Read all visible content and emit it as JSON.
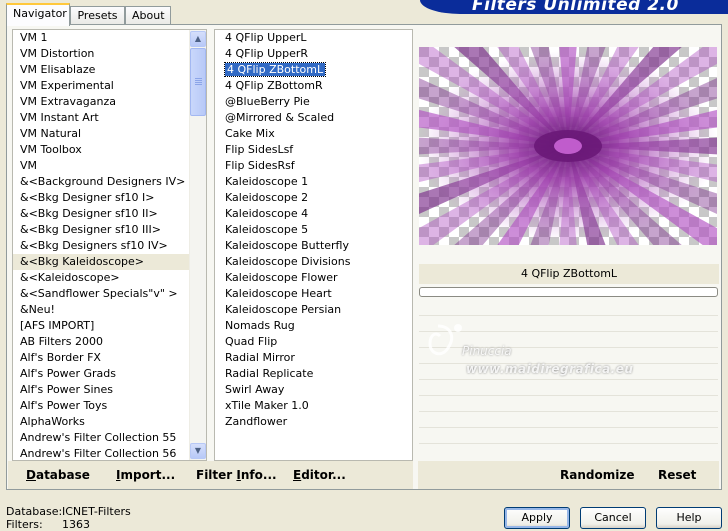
{
  "app_title": "Filters Unlimited 2.0",
  "tabs": [
    {
      "label": "Navigator",
      "active": true
    },
    {
      "label": "Presets",
      "active": false
    },
    {
      "label": "About",
      "active": false
    }
  ],
  "categories": [
    "VM 1",
    "VM Distortion",
    "VM Elisablaze",
    "VM Experimental",
    "VM Extravaganza",
    "VM Instant Art",
    "VM Natural",
    "VM Toolbox",
    "VM",
    "&<Background Designers IV>",
    "&<Bkg Designer sf10 I>",
    "&<Bkg Designer sf10 II>",
    "&<Bkg Designer sf10 III>",
    "&<Bkg Designers sf10 IV>",
    "&<Bkg Kaleidoscope>",
    "&<Kaleidoscope>",
    "&<Sandflower Specials\"v\" >",
    "&Neu!",
    "[AFS IMPORT]",
    "AB Filters 2000",
    "Alf's Border FX",
    "Alf's Power Grads",
    "Alf's Power Sines",
    "Alf's Power Toys",
    "AlphaWorks",
    "Andrew's Filter Collection 55",
    "Andrew's Filter Collection 56"
  ],
  "selected_category_index": 14,
  "filters": [
    "4 QFlip UpperL",
    "4 QFlip UpperR",
    "4 QFlip ZBottomL",
    "4 QFlip ZBottomR",
    "@BlueBerry Pie",
    "@Mirrored & Scaled",
    "Cake Mix",
    "Flip SidesLsf",
    "Flip SidesRsf",
    "Kaleidoscope 1",
    "Kaleidoscope 2",
    "Kaleidoscope 4",
    "Kaleidoscope 5",
    "Kaleidoscope Butterfly",
    "Kaleidoscope Divisions",
    "Kaleidoscope Flower",
    "Kaleidoscope Heart",
    "Kaleidoscope Persian",
    "Nomads Rug",
    "Quad Flip",
    "Radial Mirror",
    "Radial Replicate",
    "Swirl Away",
    "xTile Maker 1.0",
    "Zandflower"
  ],
  "selected_filter_index": 2,
  "preview": {
    "selected_filter_name": "4 QFlip ZBottomL",
    "progress": 0,
    "accent_color": "#b04fc2"
  },
  "watermark": {
    "line1": "Pinuccia",
    "line2": "www.maidiregrafica.eu"
  },
  "buttons_left": [
    {
      "pre": "",
      "ul": "D",
      "post": "atabase"
    },
    {
      "pre": "",
      "ul": "I",
      "post": "mport..."
    },
    {
      "pre": "Filter ",
      "ul": "I",
      "post": "nfo..."
    },
    {
      "pre": "",
      "ul": "E",
      "post": "ditor..."
    }
  ],
  "buttons_right": {
    "randomize": "Randomize",
    "reset": "Reset"
  },
  "footer": {
    "database_label": "Database:",
    "database_value": "ICNET-Filters",
    "filters_label": "Filters:",
    "filters_value": "1363"
  },
  "dialog_buttons": {
    "apply": "Apply",
    "cancel": "Cancel",
    "help": "Help"
  }
}
